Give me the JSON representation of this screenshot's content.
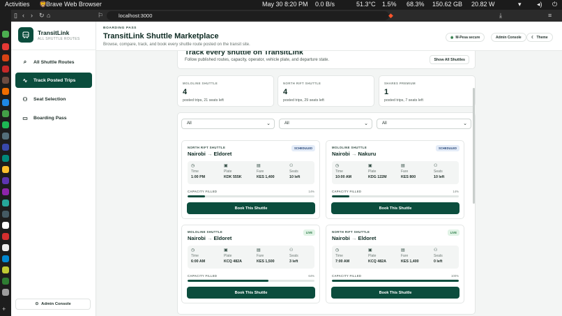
{
  "topbar": {
    "activities": "Activities",
    "browser_name": "Brave Web Browser",
    "datetime": "May 30  8:20 PM",
    "net": "0.0 B/s",
    "temp": "51.3°C",
    "cpu": "1.5%",
    "mem": "68.3%",
    "disk": "150.62 GB",
    "power": "20.82 W"
  },
  "browser": {
    "url": "localhost:3000"
  },
  "sidebar": {
    "brand_title": "TransitLink",
    "brand_sub": "ALL SHUTTLE ROUTES",
    "items": [
      {
        "label": "All Shuttle Routes",
        "icon": "search-icon"
      },
      {
        "label": "Track Posted Trips",
        "icon": "activity-icon"
      },
      {
        "label": "Seat Selection",
        "icon": "users-icon"
      },
      {
        "label": "Boarding Pass",
        "icon": "ticket-icon"
      }
    ],
    "admin_label": "Admin Console"
  },
  "header": {
    "eyebrow": "BOARDING PASS",
    "title": "TransitLink Shuttle Marketplace",
    "subtitle": "Browse, compare, track, and book every shuttle route posted on the transit site.",
    "mpesa": "M-Pesa secure",
    "admin": "Admin Console",
    "theme": "Theme"
  },
  "intro": {
    "title": "Track every shuttle on TransitLink",
    "subtitle": "Follow published routes, capacity, operator, vehicle plate, and departure state.",
    "show_all": "Show All Shuttles"
  },
  "stats": [
    {
      "label": "MOLOLINE SHUTTLE",
      "value": "4",
      "sub": "posted trips, 21 seats left"
    },
    {
      "label": "NORTH RIFT SHUTTLE",
      "value": "4",
      "sub": "posted trips, 29 seats left"
    },
    {
      "label": "SHARES PREMIUM",
      "value": "1",
      "sub": "posted trips, 7 seats left"
    }
  ],
  "filters": [
    "All",
    "All",
    "All"
  ],
  "labels": {
    "time": "Time",
    "plate": "Plate",
    "fare": "Fare",
    "seats": "Seats",
    "capacity": "CAPACITY FILLED",
    "book": "Book This Shuttle"
  },
  "trips": [
    {
      "operator": "NORTH RIFT SHUTTLE",
      "from": "Nairobi",
      "to": "Eldoret",
      "status": "SCHEDULED",
      "time": "1:00 PM",
      "plate": "KDK 555K",
      "fare": "KES 1,400",
      "seats": "10 left",
      "capacity_pct": 14,
      "capacity_text": "14%"
    },
    {
      "operator": "MOLOLINE SHUTTLE",
      "from": "Nairobi",
      "to": "Nakuru",
      "status": "SCHEDULED",
      "time": "10:00 AM",
      "plate": "KDG 122M",
      "fare": "KES 800",
      "seats": "10 left",
      "capacity_pct": 14,
      "capacity_text": "14%"
    },
    {
      "operator": "MOLOLINE SHUTTLE",
      "from": "Nairobi",
      "to": "Eldoret",
      "status": "LIVE",
      "time": "6:00 AM",
      "plate": "KCQ 482A",
      "fare": "KES 1,500",
      "seats": "3 left",
      "capacity_pct": 64,
      "capacity_text": "64%"
    },
    {
      "operator": "NORTH RIFT SHUTTLE",
      "from": "Nairobi",
      "to": "Eldoret",
      "status": "LIVE",
      "time": "7:00 AM",
      "plate": "KCQ 482A",
      "fare": "KES 1,400",
      "seats": "0 left",
      "capacity_pct": 100,
      "capacity_text": "100%"
    }
  ]
}
